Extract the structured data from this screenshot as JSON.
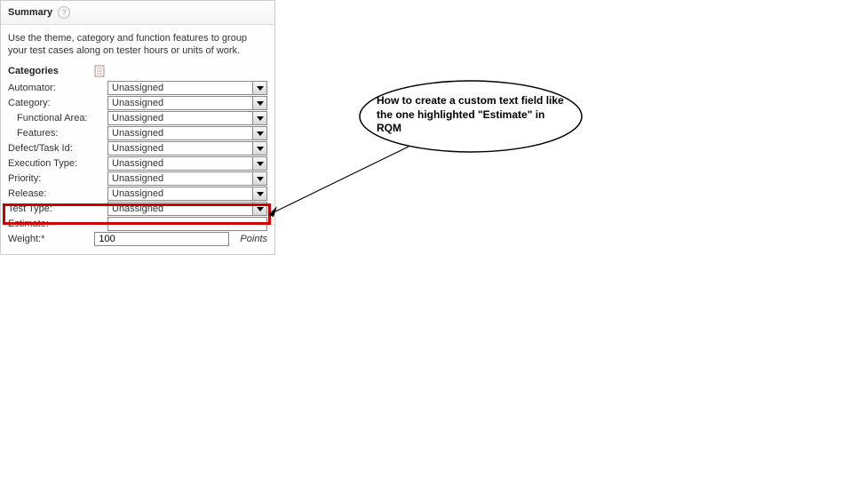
{
  "panel": {
    "title": "Summary",
    "intro": "Use the theme, category and function features to group your test cases along on tester hours or units of work.",
    "categories_label": "Categories"
  },
  "rows": {
    "automator": {
      "label": "Automator:",
      "value": "Unassigned"
    },
    "category": {
      "label": "Category:",
      "value": "Unassigned"
    },
    "funcarea": {
      "label": "Functional Area:",
      "value": "Unassigned"
    },
    "features": {
      "label": "Features:",
      "value": "Unassigned"
    },
    "defect": {
      "label": "Defect/Task Id:",
      "value": "Unassigned"
    },
    "exectype": {
      "label": "Execution Type:",
      "value": "Unassigned"
    },
    "priority": {
      "label": "Priority:",
      "value": "Unassigned"
    },
    "release": {
      "label": "Release:",
      "value": "Unassigned"
    },
    "testtype": {
      "label": "Test Type:",
      "value": "Unassigned"
    },
    "estimate": {
      "label": "Estimate:",
      "value": ""
    },
    "weight": {
      "label": "Weight:*",
      "value": "100",
      "unit": "Points"
    }
  },
  "callout": {
    "text": "How to create a custom text field like the one highlighted \"Estimate\" in RQM"
  }
}
